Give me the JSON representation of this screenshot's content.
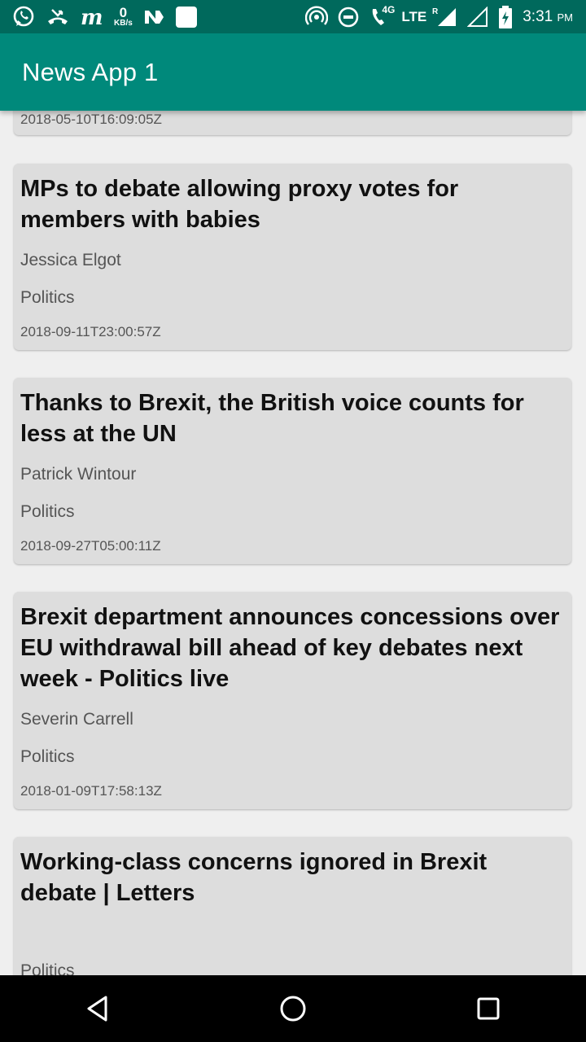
{
  "status_bar": {
    "net_speed_value": "0",
    "net_speed_unit": "KB/s",
    "network_type": "4G",
    "lte_label": "LTE",
    "roaming_label": "R",
    "time": "3:31",
    "ampm": "PM",
    "icons": [
      "whatsapp-icon",
      "missed-call-icon",
      "m-app-icon",
      "netspeed-indicator",
      "n-app-icon",
      "square-app-icon",
      "hotspot-icon",
      "dnd-icon",
      "volte-call-icon",
      "signal-icon",
      "signal-empty-icon",
      "battery-charging-icon"
    ]
  },
  "app_bar": {
    "title": "News App 1"
  },
  "partial_card": {
    "date": "2018-05-10T16:09:05Z"
  },
  "articles": [
    {
      "title": "MPs to debate allowing proxy votes for members with babies",
      "author": "Jessica Elgot",
      "section": "Politics",
      "date": "2018-09-11T23:00:57Z"
    },
    {
      "title": "Thanks to Brexit, the British voice counts for less at the UN",
      "author": "Patrick Wintour",
      "section": "Politics",
      "date": "2018-09-27T05:00:11Z"
    },
    {
      "title": "Brexit department announces concessions over EU withdrawal bill ahead of key debates next week - Politics live",
      "author": "Severin Carrell",
      "section": "Politics",
      "date": "2018-01-09T17:58:13Z"
    },
    {
      "title": "Working-class concerns ignored in Brexit debate | Letters",
      "author": "",
      "section": "Politics",
      "date": ""
    }
  ],
  "nav_bar": {
    "buttons": [
      "back-icon",
      "home-icon",
      "recents-icon"
    ]
  },
  "colors": {
    "status_bar": "#00695c",
    "app_bar": "#00897b",
    "card_bg": "#dddddd",
    "page_bg": "#efefef"
  }
}
